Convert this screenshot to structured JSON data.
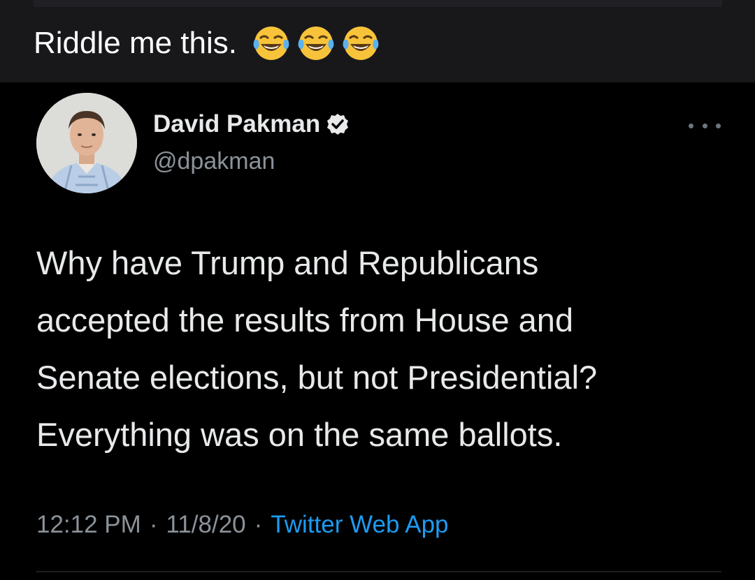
{
  "post": {
    "caption": "Riddle me this.",
    "emojis": [
      "face-with-tears-of-joy-icon",
      "face-with-tears-of-joy-icon",
      "face-with-tears-of-joy-icon"
    ]
  },
  "tweet": {
    "author": {
      "display_name": "David Pakman",
      "handle": "@dpakman",
      "verified": true
    },
    "text_lines": [
      "Why have Trump and Republicans",
      "accepted the results from House and",
      "Senate elections, but not Presidential?",
      "Everything was on the same ballots."
    ],
    "time": "12:12 PM",
    "date": "11/8/20",
    "separator": "·",
    "source": "Twitter Web App"
  },
  "colors": {
    "header_bg": "#18181b",
    "tweet_bg": "#000000",
    "text": "#e7e9ea",
    "secondary": "#8b9299",
    "accent": "#1d9bf0"
  }
}
